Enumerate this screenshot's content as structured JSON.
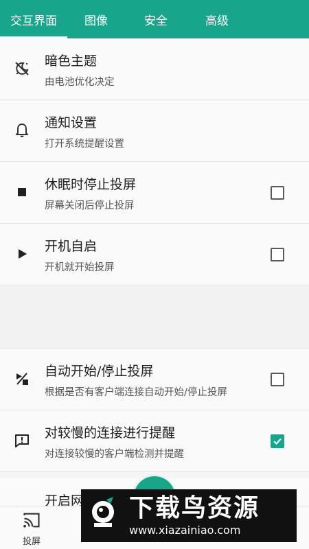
{
  "tabs": [
    {
      "label": "交互界面"
    },
    {
      "label": "图像"
    },
    {
      "label": "安全"
    },
    {
      "label": "高级"
    }
  ],
  "settings": [
    {
      "title": "暗色主题",
      "subtitle": "由电池优化决定",
      "icon": "dark-theme-icon"
    },
    {
      "title": "通知设置",
      "subtitle": "打开系统提醒设置",
      "icon": "bell-icon"
    },
    {
      "title": "休眠时停止投屏",
      "subtitle": "屏幕关闭后停止投屏",
      "icon": "stop-icon",
      "checked": false
    },
    {
      "title": "开机自启",
      "subtitle": "开机就开始投屏",
      "icon": "play-icon",
      "checked": false
    },
    {
      "title": "自动开始/停止投屏",
      "subtitle": "根据是否有客户端连接自动开始/停止投屏",
      "icon": "auto-start-stop-icon",
      "checked": false
    },
    {
      "title": "对较慢的连接进行提醒",
      "subtitle": "对连接较慢的客户端检测并提醒",
      "icon": "feedback-alert-icon",
      "checked": true
    },
    {
      "title": "开启网"
    }
  ],
  "bottom_nav": [
    {
      "label": "投屏",
      "icon": "cast-icon"
    }
  ],
  "watermark": {
    "main": "下载鸟资源",
    "url": "www.xiazainiao.com"
  },
  "colors": {
    "accent": "#17a58c",
    "watermark_bg": "#111111"
  }
}
